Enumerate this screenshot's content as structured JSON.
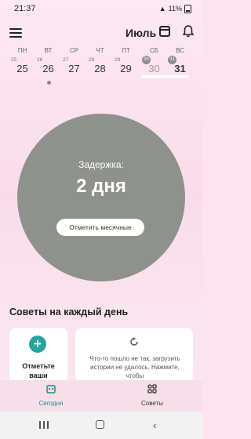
{
  "status_bar": {
    "time": "21:37",
    "battery": "11%"
  },
  "header": {
    "month": "Июль"
  },
  "week": [
    {
      "weekday": "ПН",
      "small": "25",
      "date": "25"
    },
    {
      "weekday": "ВТ",
      "small": "26",
      "date": "26"
    },
    {
      "weekday": "СР",
      "small": "27",
      "date": "27"
    },
    {
      "weekday": "ЧТ",
      "small": "28",
      "date": "28"
    },
    {
      "weekday": "ПТ",
      "small": "29",
      "date": "29"
    },
    {
      "weekday": "СБ",
      "small": "30",
      "date": "30"
    },
    {
      "weekday": "ВС",
      "small": "31",
      "date": "31"
    }
  ],
  "status_circle": {
    "label": "Задержка:",
    "value": "2 дня",
    "button": "Отметить месячные"
  },
  "tips": {
    "title": "Советы на каждый день",
    "card1": "Отметьте ваши",
    "card2": "Что-то пошло не так, загрузить истории не удалось. Нажмите, чтобы"
  },
  "bottom_nav": {
    "today": "Сегодня",
    "tips": "Советы"
  },
  "colors": {
    "accent": "#1a8f87",
    "circle": "#8e918c",
    "background": "#fbe4ee"
  }
}
